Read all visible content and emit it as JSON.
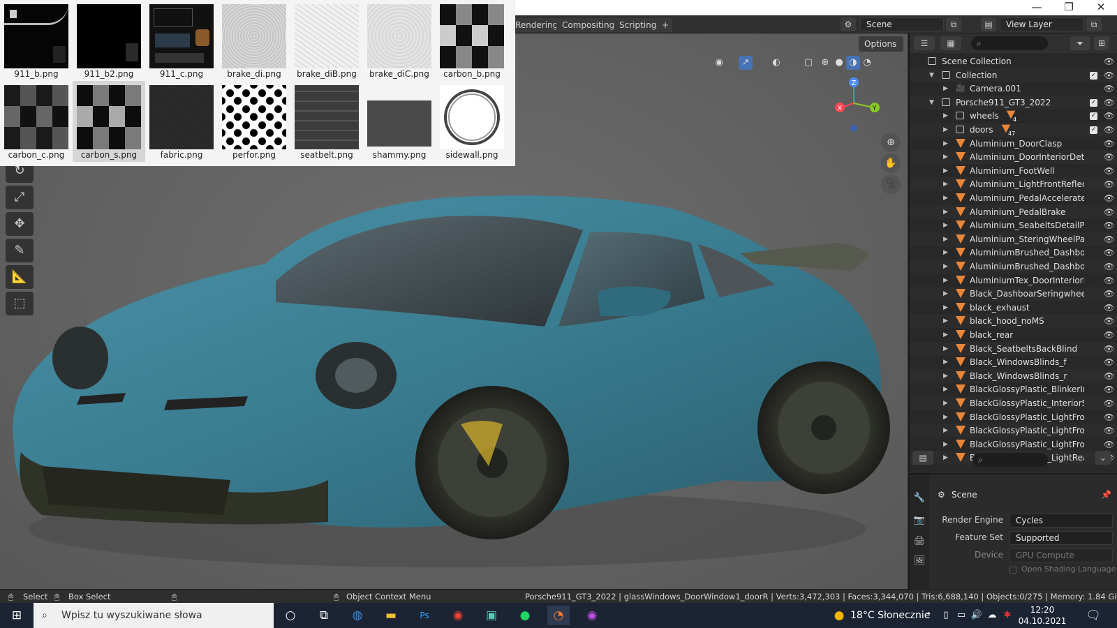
{
  "window": {
    "minimize": "—",
    "maximize": "❐",
    "close": "✕"
  },
  "workspace_tabs": [
    "Rendering",
    "Compositing",
    "Scripting",
    "+"
  ],
  "scene_selector": "Scene",
  "view_layer": "View Layer",
  "viewport": {
    "options_label": "Options",
    "gizmo_axes": {
      "x": "X",
      "y": "Y",
      "z": "Z"
    }
  },
  "image_browser": {
    "rows": [
      [
        "911_b.png",
        "911_b2.png",
        "911_c.png",
        "brake_di.png",
        "brake_diB.png",
        "brake_diC.png",
        "carbon_b.png"
      ],
      [
        "carbon_c.png",
        "carbon_s.png",
        "fabric.png",
        "perfor.png",
        "seatbelt.png",
        "shammy.png",
        "sidewall.png"
      ]
    ],
    "selected": "carbon_s.png"
  },
  "outliner": {
    "search_placeholder": "",
    "rows": [
      {
        "label": "Scene Collection",
        "type": "scene",
        "depth": 0
      },
      {
        "label": "Collection",
        "type": "collection",
        "depth": 1,
        "expanded": true,
        "checked": true
      },
      {
        "label": "Camera.001",
        "type": "camera",
        "depth": 2
      },
      {
        "label": "Porsche911_GT3_2022",
        "type": "collection",
        "depth": 1,
        "expanded": true,
        "checked": true
      },
      {
        "label": "wheels",
        "type": "collection",
        "depth": 2,
        "badge": "4",
        "checked": true
      },
      {
        "label": "doors",
        "type": "collection",
        "depth": 2,
        "badge": "47",
        "checked": true
      },
      {
        "label": "Aluminium_DoorClasp",
        "type": "mesh",
        "depth": 2
      },
      {
        "label": "Aluminium_DoorInteriorDetailPar",
        "type": "mesh",
        "depth": 2
      },
      {
        "label": "Aluminium_FootWell",
        "type": "mesh",
        "depth": 2
      },
      {
        "label": "Aluminium_LightFrontReflectorBc",
        "type": "mesh",
        "depth": 2
      },
      {
        "label": "Aluminium_PedalAccelerateDeta",
        "type": "mesh",
        "depth": 2
      },
      {
        "label": "Aluminium_PedalBrake",
        "type": "mesh",
        "depth": 2
      },
      {
        "label": "Aluminium_SeabeltsDetailPart",
        "type": "mesh",
        "depth": 2
      },
      {
        "label": "Aluminium_SteringWheelPaddles",
        "type": "mesh",
        "depth": 2
      },
      {
        "label": "AluminiumBrushed_DashboardDe",
        "type": "mesh",
        "depth": 2
      },
      {
        "label": "AluminiumBrushed_DashboardSc",
        "type": "mesh",
        "depth": 2
      },
      {
        "label": "AluminiumTex_DoorInteriorBotto",
        "type": "mesh",
        "depth": 2
      },
      {
        "label": "Black_DashboarSeringwheelBack",
        "type": "mesh",
        "depth": 2
      },
      {
        "label": "black_exhaust",
        "type": "mesh",
        "depth": 2
      },
      {
        "label": "black_hood_noMS",
        "type": "mesh",
        "depth": 2
      },
      {
        "label": "black_rear",
        "type": "mesh",
        "depth": 2
      },
      {
        "label": "Black_SeatbeltsBackBlind",
        "type": "mesh",
        "depth": 2
      },
      {
        "label": "Black_WindowsBlinds_f",
        "type": "mesh",
        "depth": 2
      },
      {
        "label": "Black_WindowsBlinds_r",
        "type": "mesh",
        "depth": 2
      },
      {
        "label": "BlackGlossyPlastic_BlinkerInteric",
        "type": "mesh",
        "depth": 2
      },
      {
        "label": "BlackGlossyPlastic_InteriorSidesI",
        "type": "mesh",
        "depth": 2
      },
      {
        "label": "BlackGlossyPlastic_LightFrontInt",
        "type": "mesh",
        "depth": 2
      },
      {
        "label": "BlackGlossyPlastic_LightFrontInt",
        "type": "mesh",
        "depth": 2
      },
      {
        "label": "BlackGlossyPlastic_LightFrontRe",
        "type": "mesh",
        "depth": 2
      },
      {
        "label": "BlackGlossyPlastic_LightRearFrai",
        "type": "mesh",
        "depth": 2
      }
    ]
  },
  "properties": {
    "context": "Scene",
    "fields": [
      {
        "label": "Render Engine",
        "value": "Cycles"
      },
      {
        "label": "Feature Set",
        "value": "Supported"
      },
      {
        "label": "Device",
        "value": "GPU Compute"
      }
    ],
    "checkbox_label": "Open Shading Language"
  },
  "statusbar": {
    "select": "Select",
    "box_select": "Box Select",
    "context_menu": "Object Context Menu",
    "stats": "Porsche911_GT3_2022 | glassWindows_DoorWindow1_doorR | Verts:3,472,303 | Faces:3,344,070 | Tris:6,688,140 | Objects:0/275 | Memory: 1.84 GiB | VRAM: 2.1/4"
  },
  "taskbar": {
    "search_placeholder": "Wpisz tu wyszukiwane słowa",
    "weather": "18°C  Słonecznie",
    "time": "12:20",
    "date": "04.10.2021",
    "apps": [
      "cortana-circle",
      "task-view",
      "edge",
      "file-explorer",
      "photoshop",
      "chrome",
      "substance",
      "spotify",
      "blender",
      "other-app"
    ]
  },
  "colors": {
    "accent_blue": "#4772b3",
    "mesh_orange": "#e8863a",
    "car_paint": "#3f8296"
  }
}
